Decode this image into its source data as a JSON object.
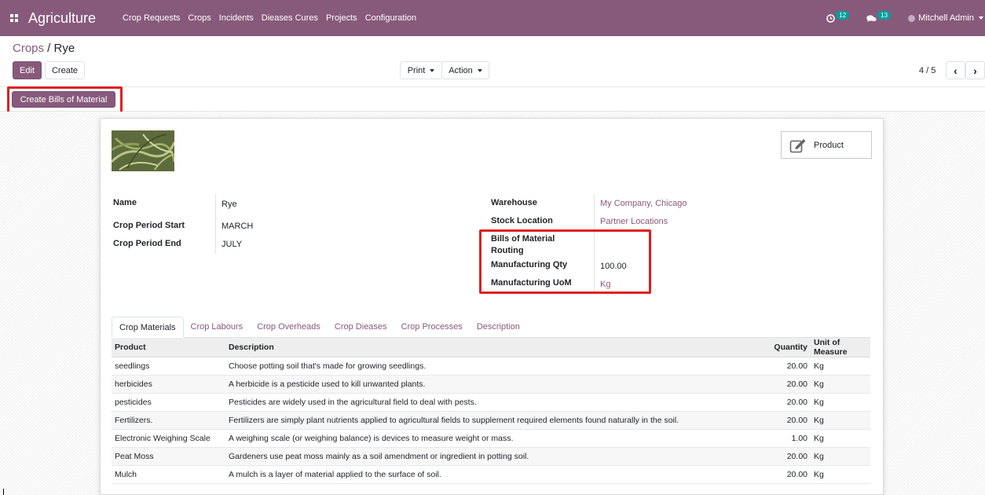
{
  "navbar": {
    "brand": "Agriculture",
    "menu": [
      "Crop Requests",
      "Crops",
      "Incidents",
      "Dieases Cures",
      "Projects",
      "Configuration"
    ],
    "activity_count": "12",
    "message_count": "13",
    "user": "Mitchell Admin",
    "bg_color": "#875a7b"
  },
  "breadcrumb": {
    "parent": "Crops",
    "separator": " / ",
    "current": "Rye"
  },
  "buttons": {
    "edit": "Edit",
    "create": "Create",
    "print": "Print",
    "action": "Action",
    "create_bom": "Create Bills of Material"
  },
  "pager": {
    "value": "4 / 5"
  },
  "product_button": {
    "label": "Product",
    "icon": "edit-icon"
  },
  "fields_left": [
    {
      "label": "Name",
      "value": "Rye"
    },
    {
      "label": "Crop Period Start",
      "value": "MARCH"
    },
    {
      "label": "Crop Period End",
      "value": "JULY"
    }
  ],
  "fields_right": [
    {
      "label": "Warehouse",
      "value": "My Company, Chicago"
    },
    {
      "label": "Stock Location",
      "value": "Partner Locations"
    },
    {
      "label": "Bills of Material",
      "value": ""
    },
    {
      "label": "Routing",
      "value": ""
    },
    {
      "label": "Manufacturing Qty",
      "value": "100.00"
    },
    {
      "label": "Manufacturing UoM",
      "value": "Kg"
    }
  ],
  "tabs": [
    "Crop Materials",
    "Crop Labours",
    "Crop Overheads",
    "Crop Dieases",
    "Crop Processes",
    "Description"
  ],
  "table": {
    "headers": [
      "Product",
      "Description",
      "Quantity",
      "Unit of Measure"
    ],
    "rows": [
      [
        "seedlings",
        "Choose potting soil that's made for growing seedlings.",
        "20.00",
        "Kg"
      ],
      [
        "herbicides",
        "A herbicide is a pesticide used to kill unwanted plants.",
        "20.00",
        "Kg"
      ],
      [
        "pesticides",
        "Pesticides are widely used in the agricultural field to deal with pests.",
        "20.00",
        "Kg"
      ],
      [
        "Fertilizers.",
        "Fertilizers are simply plant nutrients applied to agricultural fields to supplement required elements found naturally in the soil.",
        "20.00",
        "Kg"
      ],
      [
        "Electronic Weighing Scale",
        "A weighing scale (or weighing balance) is devices to measure weight or mass.",
        "1.00",
        "Kg"
      ],
      [
        "Peat Moss",
        "Gardeners use peat moss mainly as a soil amendment or ingredient in potting soil.",
        "20.00",
        "Kg"
      ],
      [
        "Mulch",
        "A mulch is a layer of material applied to the surface of soil.",
        "20.00",
        "Kg"
      ]
    ]
  }
}
